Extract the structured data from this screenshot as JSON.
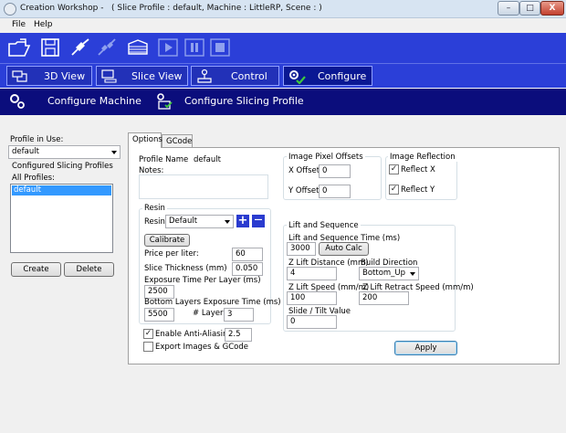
{
  "window": {
    "title": "Creation Workshop -   ( Slice Profile : default, Machine : LittleRP, Scene : )",
    "minimize": "–",
    "maximize": "□",
    "close": "X"
  },
  "menu": {
    "file": "File",
    "help": "Help"
  },
  "toolbar_icons": [
    "open-folder-icon",
    "save-disk-icon",
    "connect-plug-icon",
    "disconnect-plug-icon",
    "slice-layers-icon",
    "play-icon",
    "pause-icon",
    "stop-icon"
  ],
  "main_tabs": [
    {
      "label": "3D View",
      "icon": "3d-view-icon"
    },
    {
      "label": "Slice View",
      "icon": "slice-view-icon"
    },
    {
      "label": "Control",
      "icon": "control-joystick-icon"
    },
    {
      "label": "Configure",
      "icon": "configure-gear-icon",
      "active": true
    }
  ],
  "sub_tabs": [
    {
      "label": "Configure Machine",
      "icon": "gears-icon"
    },
    {
      "label": "Configure Slicing Profile",
      "icon": "slicing-profile-icon"
    }
  ],
  "left": {
    "profile_in_use_label": "Profile in Use:",
    "profile_in_use_value": "default",
    "configured_label": "Configured Slicing Profiles",
    "all_profiles_label": "All Profiles:",
    "profiles": [
      "default"
    ],
    "create_label": "Create",
    "delete_label": "Delete"
  },
  "options_tabs": {
    "options": "Options",
    "gcode": "GCode"
  },
  "profile": {
    "name_label": "Profile Name",
    "name_value": "default",
    "notes_label": "Notes:"
  },
  "resin": {
    "group_title": "Resin",
    "resin_label": "Resin:",
    "resin_value": "Default",
    "add_symbol": "+",
    "remove_symbol": "—",
    "calibrate_label": "Calibrate",
    "price_label": "Price per liter:",
    "price_value": "60",
    "thickness_label": "Slice Thickness (mm)",
    "thickness_value": "0.050",
    "exposure_label": "Exposure Time Per Layer (ms)",
    "exposure_value": "2500",
    "bottom_exposure_label": "Bottom Layers Exposure Time (ms)",
    "bottom_exposure_value": "5500",
    "layers_label": "# Layers",
    "layers_value": "3"
  },
  "antialias": {
    "label": "Enable Anti-Aliasing",
    "checked": true,
    "value": "2.5"
  },
  "export": {
    "label": "Export Images & GCode",
    "checked": false
  },
  "pixel_offsets": {
    "title": "Image Pixel Offsets",
    "x_label": "X Offset",
    "x_value": "0",
    "y_label": "Y Offset",
    "y_value": "0"
  },
  "reflection": {
    "title": "Image Reflection",
    "x_label": "Reflect X",
    "x_checked": true,
    "y_label": "Reflect Y",
    "y_checked": true
  },
  "lift": {
    "title": "Lift and Sequence",
    "time_label": "Lift and Sequence Time (ms)",
    "time_value": "3000",
    "autocalc_label": "Auto Calc",
    "zdist_label": "Z Lift Distance (mm)",
    "zdist_value": "4",
    "direction_label": "Build Direction",
    "direction_value": "Bottom_Up",
    "zspeed_label": "Z Lift Speed (mm/m)",
    "zspeed_value": "100",
    "zretract_label": "Z Lift Retract Speed (mm/m)",
    "zretract_value": "200",
    "tilt_label": "Slide / Tilt Value",
    "tilt_value": "0"
  },
  "apply_label": "Apply",
  "colors": {
    "toolbar_blue": "#2b3fd8",
    "subbar_navy": "#0b0d7c",
    "selection": "#3399ff"
  }
}
